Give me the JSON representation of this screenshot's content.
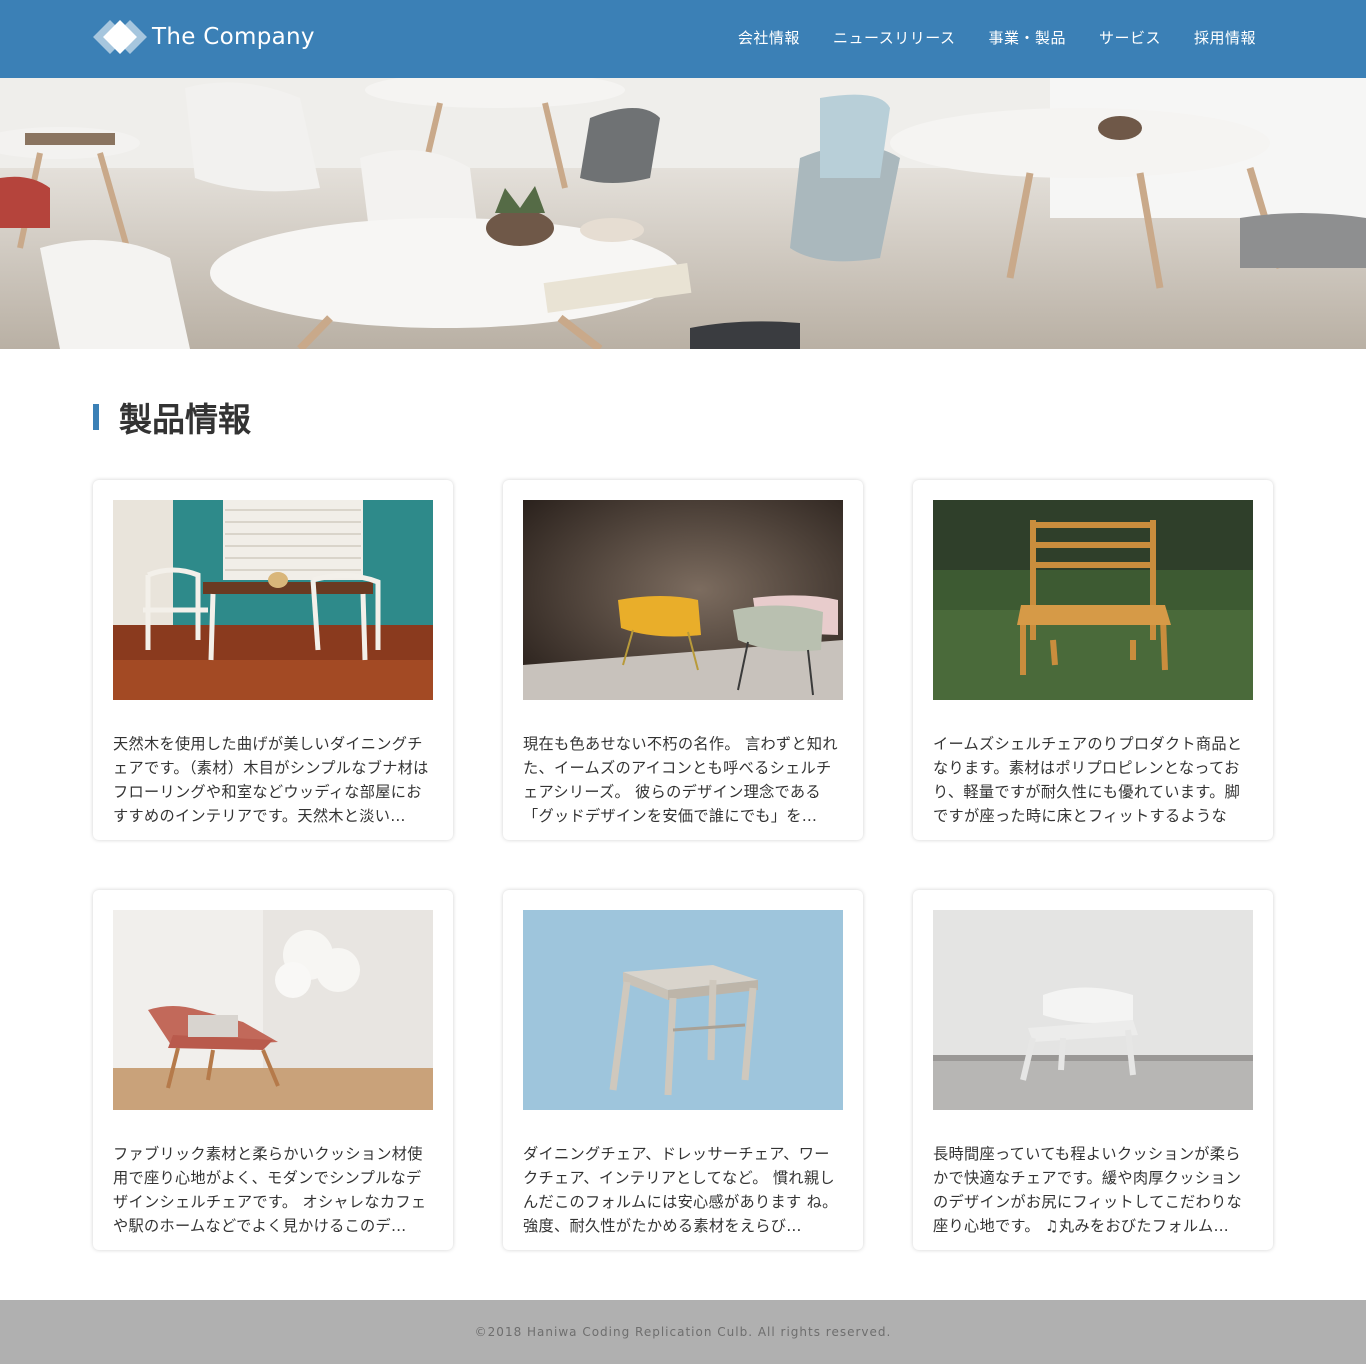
{
  "header": {
    "logo_text": "The Company",
    "nav": [
      "会社情報",
      "ニュースリリース",
      "事業・製品",
      "サービス",
      "採用情報"
    ]
  },
  "section": {
    "title": "製品情報"
  },
  "products": [
    {
      "description": "天然木を使用した曲げが美しいダイニングチェアです。（素材）木目がシンプルなブナ材はフローリングや和室などウッディな部屋におすすめのインテリアです。天然木と淡い…"
    },
    {
      "description": "現在も色あせない不朽の名作。 言わずと知れた、イームズのアイコンとも呼べるシェルチェアシリーズ。 彼らのデザイン理念である「グッドデザインを安価で誰にでも」を…"
    },
    {
      "description": "イームズシェルチェアのりプロダクト商品となります。素材はポリプロピレンとなっており、軽量ですが耐久性にも優れています。脚ですが座った時に床とフィットするような遊…"
    },
    {
      "description": "ファブリック素材と柔らかいクッション材使用で座り心地がよく、モダンでシンプルなデザインシェルチェアです。 オシャレなカフェや駅のホームなどでよく見かけるこのデ…"
    },
    {
      "description": "ダイニングチェア、ドレッサーチェア、ワークチェア、インテリアとしてなど。 慣れ親しんだこのフォルムには安心感があります ね。強度、耐久性がたかめる素材をえらび…"
    },
    {
      "description": "長時間座っていても程よいクッションが柔らかで快適なチェアです。緩や肉厚クッションのデザインがお尻にフィットしてこだわりな座り心地です。 ♫丸みをおびたフォルム…"
    }
  ],
  "footer": {
    "copyright": "©2018 Haniwa Coding Replication Culb. All rights reserved."
  },
  "colors": {
    "brand": "#3b80b6",
    "footer_bg": "#b0b0b0"
  }
}
